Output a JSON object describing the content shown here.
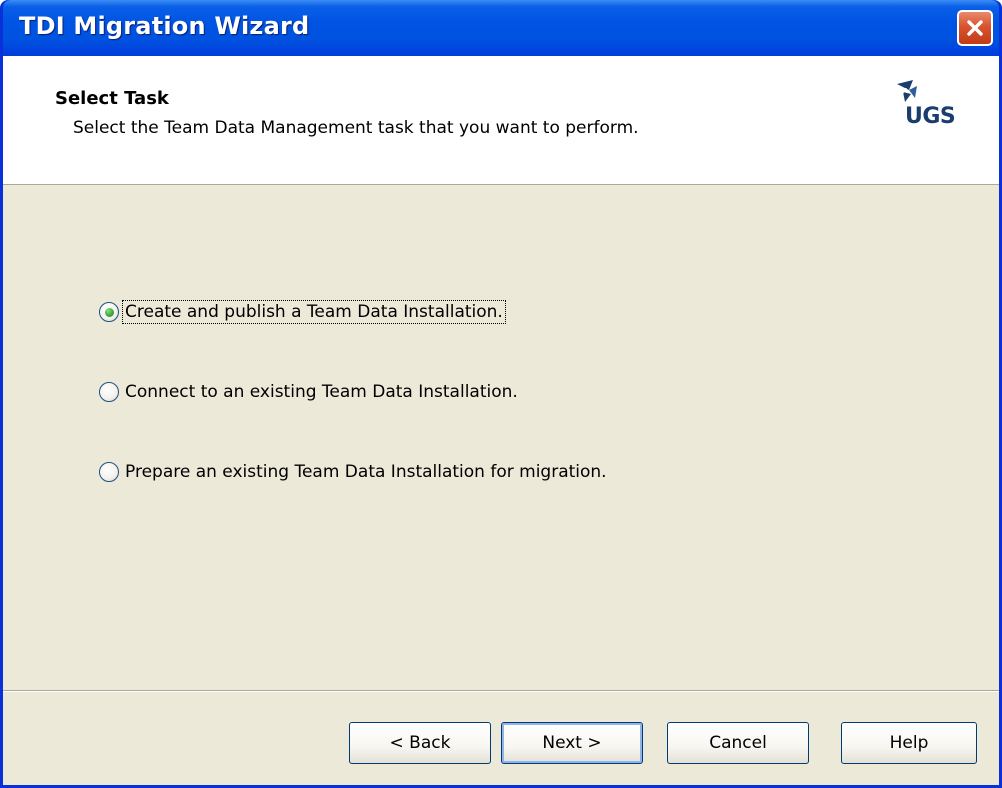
{
  "window": {
    "title": "TDI Migration Wizard"
  },
  "header": {
    "title": "Select Task",
    "subtitle": "Select the Team Data Management task that you want to perform.",
    "logo_text": "UGS"
  },
  "options": [
    {
      "label": "Create and publish a Team Data Installation.",
      "selected": true
    },
    {
      "label": "Connect to an existing Team Data Installation.",
      "selected": false
    },
    {
      "label": "Prepare an existing Team Data Installation for migration.",
      "selected": false
    }
  ],
  "buttons": {
    "back": "< Back",
    "next": "Next >",
    "cancel": "Cancel",
    "help": "Help"
  },
  "icons": {
    "close": "close-icon",
    "logo": "ugs-logo-icon",
    "radio_selected": "radio-selected-icon",
    "radio_unselected": "radio-unselected-icon"
  },
  "colors": {
    "titlebar": "#0054e3",
    "close_button": "#d9532e",
    "dialog_bg": "#ece9d8",
    "header_bg": "#ffffff",
    "radio_selected": "#3da53d"
  }
}
